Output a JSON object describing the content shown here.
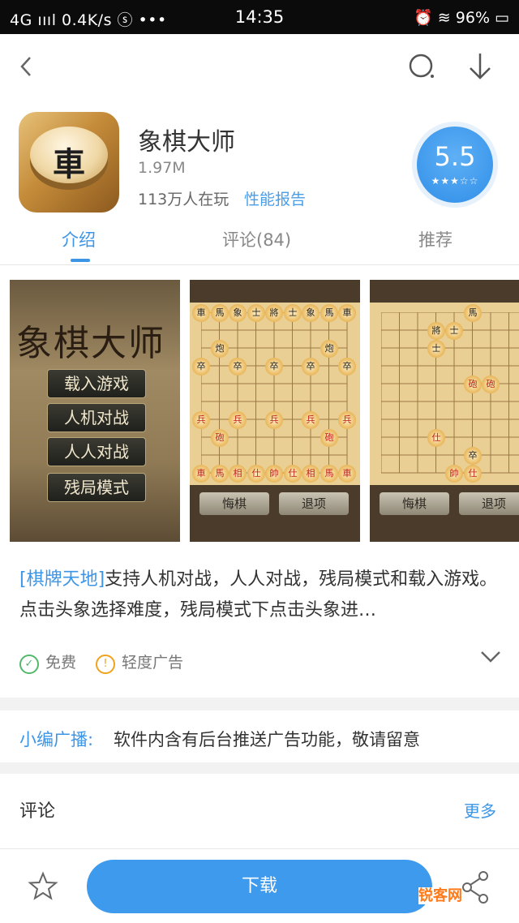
{
  "status_bar": {
    "left": "4G ıııl  0.4K/s  ⓢ  •••",
    "time": "14:35",
    "right": "⏰  ≋  96%  ▭"
  },
  "header": {
    "back_icon": "chevron-left-icon",
    "search_icon": "search-icon",
    "download_icon": "download-arrow-icon"
  },
  "app": {
    "name": "象棋大师",
    "size": "1.97M",
    "players": "113万人在玩",
    "report_link": "性能报告",
    "icon_glyph": "車",
    "score": "5.5",
    "score_stars": "★★★☆☆"
  },
  "tabs": [
    {
      "label": "介绍",
      "active": true
    },
    {
      "label": "评论(84)",
      "active": false
    },
    {
      "label": "推荐",
      "active": false
    }
  ],
  "screenshots": {
    "s1": {
      "title": "象棋大师",
      "menu": [
        "载入游戏",
        "人机对战",
        "人人对战",
        "残局模式"
      ]
    },
    "s2": {
      "buttons": [
        "悔棋",
        "退项"
      ]
    },
    "s3": {
      "buttons": [
        "悔棋",
        "退项"
      ]
    }
  },
  "description": {
    "tag": "[棋牌天地]",
    "text": "支持人机对战，人人对战，残局模式和载入游戏。点击头象选择难度，残局模式下点击头象进…"
  },
  "badges": [
    {
      "label": "免费",
      "icon": "check-circle-icon",
      "color": "#53b86a"
    },
    {
      "label": "轻度广告",
      "icon": "exclamation-circle-icon",
      "color": "#f0a21b"
    }
  ],
  "notice": {
    "label": "小编广播:",
    "text": "软件内含有后台推送广告功能，敬请留意"
  },
  "comments": {
    "title": "评论",
    "more": "更多"
  },
  "bottom": {
    "download_label": "下载",
    "favorite_icon": "star-outline-icon",
    "share_icon": "share-icon"
  },
  "watermark": "锐客网"
}
